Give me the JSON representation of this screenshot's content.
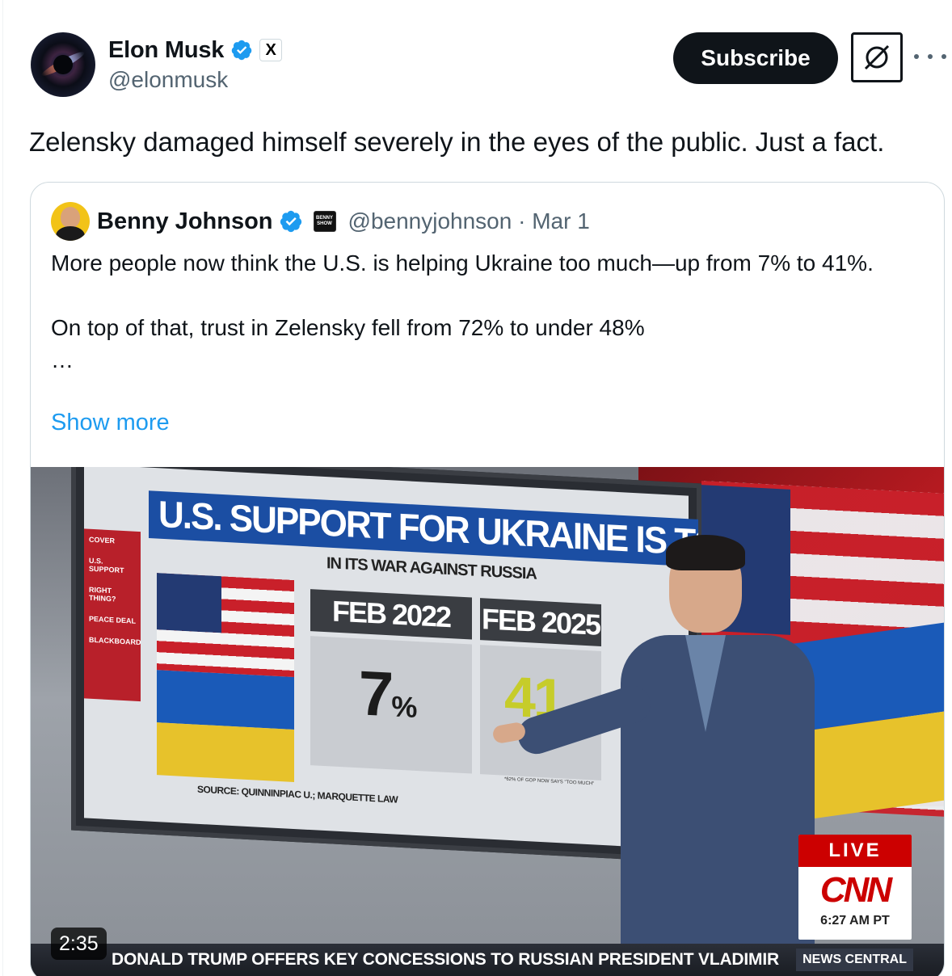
{
  "author": {
    "display_name": "Elon Musk",
    "handle": "@elonmusk",
    "affiliate_badge": "X"
  },
  "actions": {
    "subscribe_label": "Subscribe",
    "grok_icon": "grok-icon",
    "more_icon": "more-icon"
  },
  "tweet": {
    "text": "Zelensky damaged himself severely in the eyes of the public. Just a fact."
  },
  "quote": {
    "display_name": "Benny Johnson",
    "affiliate_badge": "BENNY SHOW",
    "handle_date": "@bennyjohnson · Mar 1",
    "text": "More people now think the U.S. is helping Ukraine too much—up from 7% to 41%.\n\nOn top of that, trust in Zelensky fell from 72% to under 48%\n…",
    "show_more": "Show more"
  },
  "video": {
    "duration": "2:35",
    "screen_headline": "U.S. SUPPORT FOR UKRAINE IS TOO MUCH",
    "screen_subhead": "IN ITS WAR AGAINST RUSSIA",
    "col1_label": "FEB 2022",
    "col2_label": "FEB 2025",
    "col1_value": "7",
    "col1_unit": "%",
    "col2_value": "41",
    "source": "SOURCE: QUINNINPIAC U.; MARQUETTE LAW",
    "footnote": "*62% OF GOP NOW SAYS \"TOO MUCH\"",
    "menu": [
      "COVER",
      "U.S. SUPPORT",
      "RIGHT THING?",
      "PEACE DEAL",
      "BLACKBOARD"
    ],
    "live_label": "LIVE",
    "network": "CNN",
    "live_time": "6:27 AM PT",
    "ticker": "DONALD TRUMP OFFERS KEY CONCESSIONS TO RUSSIAN PRESIDENT VLADIMIR",
    "ticker_tag": "NEWS CENTRAL"
  },
  "colors": {
    "accent_blue": "#1d9bf0",
    "verified_blue": "#1d9bf0",
    "text_primary": "#0f1419",
    "text_secondary": "#536471",
    "cnn_red": "#cc0000"
  }
}
